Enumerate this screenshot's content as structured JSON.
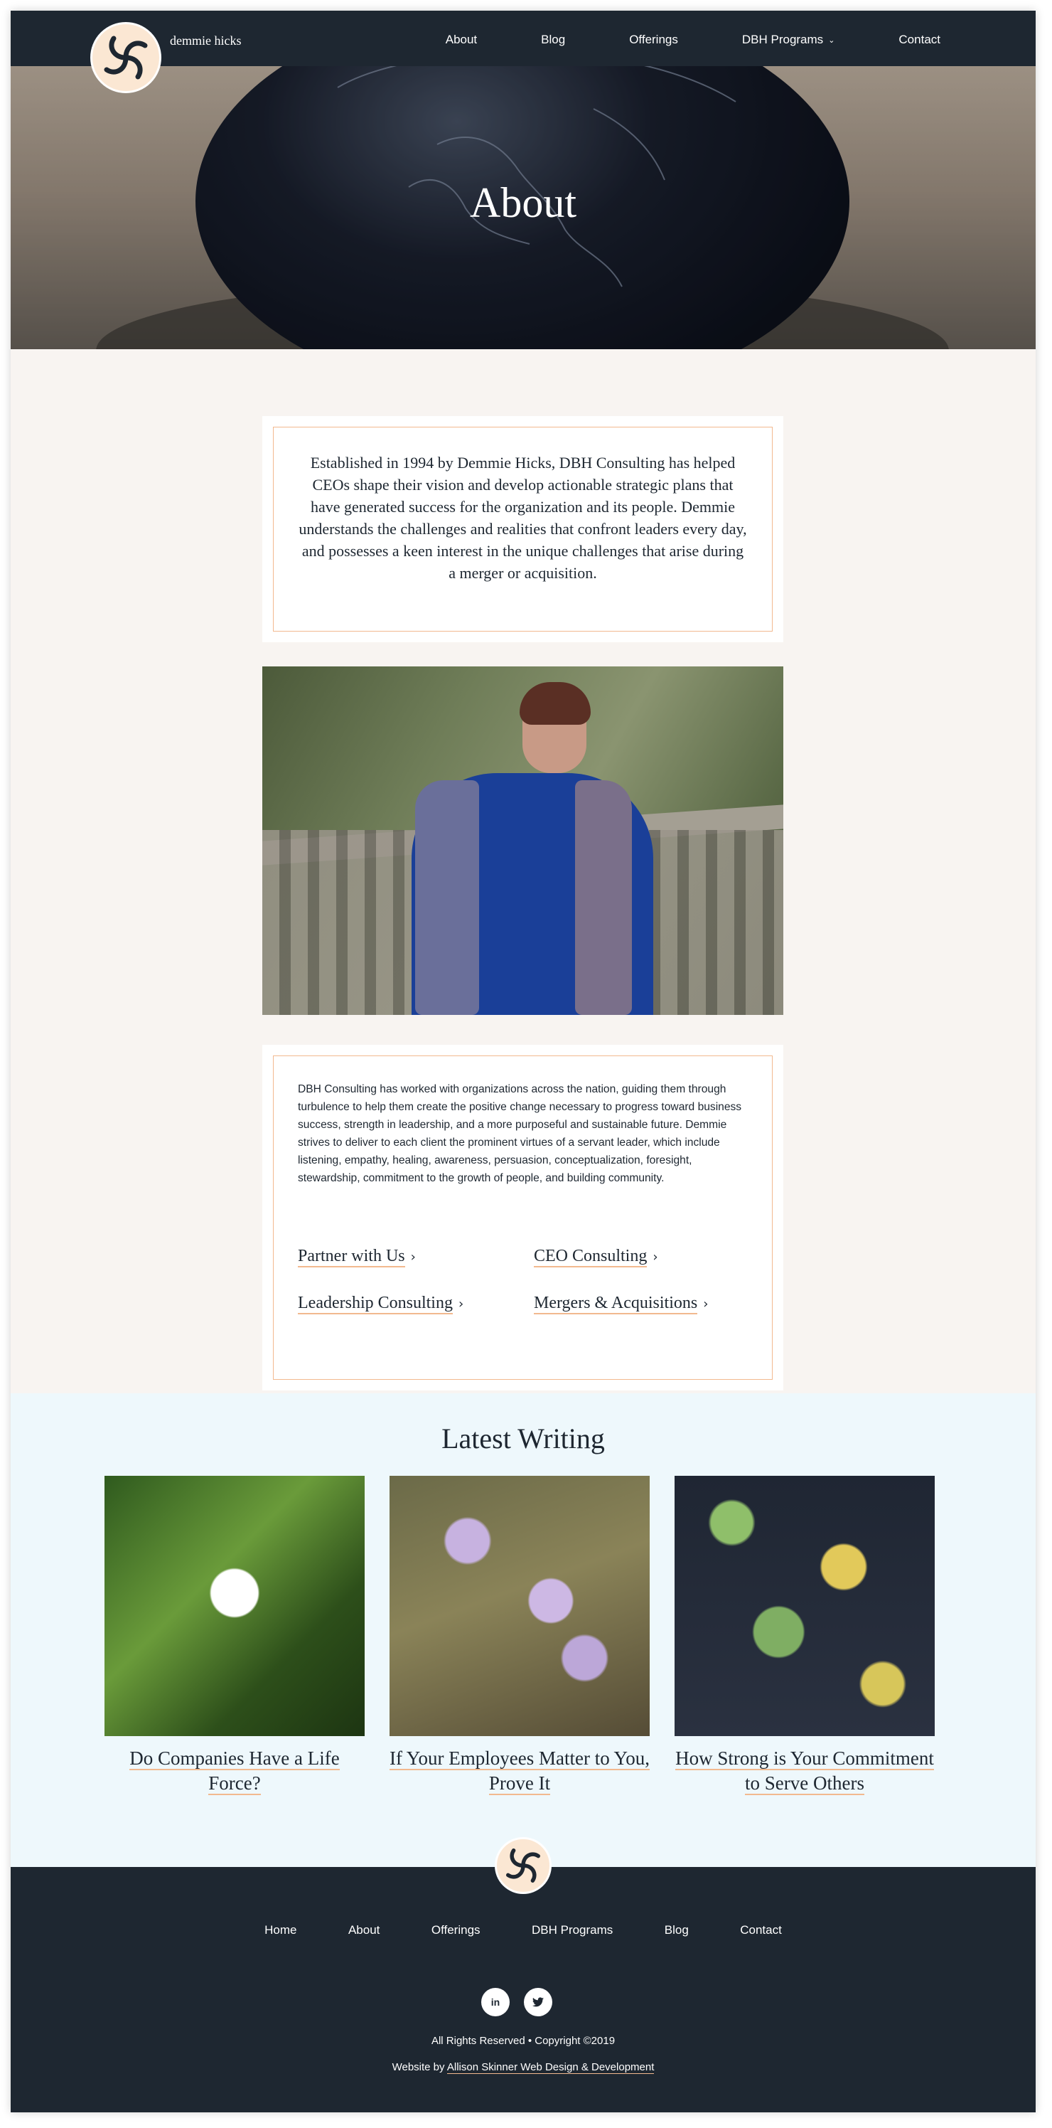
{
  "header": {
    "brand": "demmie hicks",
    "nav": [
      {
        "label": "About"
      },
      {
        "label": "Blog"
      },
      {
        "label": "Offerings"
      },
      {
        "label": "DBH Programs",
        "has_dropdown": true
      },
      {
        "label": "Contact"
      }
    ]
  },
  "hero": {
    "title": "About"
  },
  "intro": {
    "text": "Established in 1994 by Demmie Hicks, DBH Consulting has helped CEOs shape their vision and develop actionable strategic plans that have generated success for the organization and its people. Demmie understands the challenges and realities that confront leaders every day, and possesses a keen interest in the unique challenges that arise during a merger or acquisition."
  },
  "about": {
    "body": "DBH Consulting has worked with organizations across the nation, guiding them through turbulence to help them create the positive change necessary to progress toward business success, strength in leadership, and a more purposeful and sustainable future. Demmie strives to deliver to each client the prominent virtues of a servant leader, which include listening, empathy, healing, awareness, persuasion, conceptualization, foresight, stewardship, commitment to the growth of people, and building community.",
    "links": [
      {
        "label": "Partner with Us"
      },
      {
        "label": "CEO Consulting"
      },
      {
        "label": "Leadership Consulting"
      },
      {
        "label": "Mergers & Acquisitions"
      }
    ]
  },
  "writing": {
    "heading": "Latest Writing",
    "posts": [
      {
        "title": "Do Companies Have a Life Force?"
      },
      {
        "title": "If Your Employees Matter to You, Prove It"
      },
      {
        "title": "How Strong is Your Commitment to Serve Others"
      }
    ]
  },
  "footer": {
    "nav": [
      {
        "label": "Home"
      },
      {
        "label": "About"
      },
      {
        "label": "Offerings"
      },
      {
        "label": "DBH Programs"
      },
      {
        "label": "Blog"
      },
      {
        "label": "Contact"
      }
    ],
    "social": [
      {
        "icon": "linkedin-icon",
        "glyph": "in"
      },
      {
        "icon": "twitter-icon",
        "glyph": "🐦"
      }
    ],
    "rights": "All Rights Reserved • Copyright ©2019",
    "credit_prefix": "Website by ",
    "credit_link": "Allison Skinner Web Design & Development"
  },
  "colors": {
    "dark": "#1e2731",
    "cream": "#f8f4f1",
    "accent": "#f2b98f",
    "light_blue": "#eef8fc"
  }
}
